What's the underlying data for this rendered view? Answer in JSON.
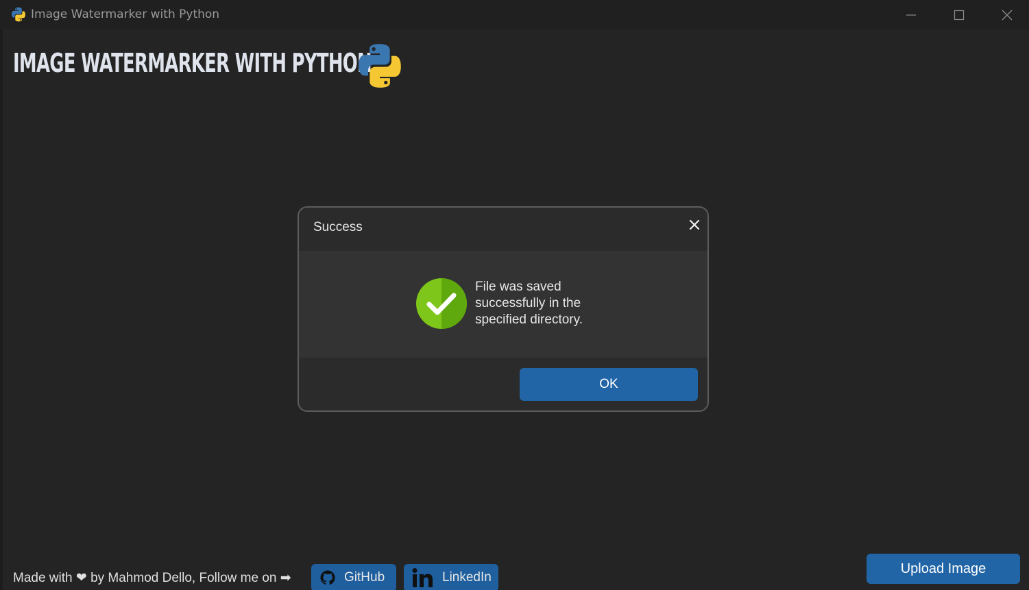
{
  "window": {
    "title": "Image Watermarker with Python",
    "icons": [
      "python-logo-icon",
      "minimize-icon",
      "maximize-icon",
      "close-icon"
    ]
  },
  "header": {
    "title": "IMAGE WATERMARKER WITH PYTHON",
    "logo_icon": "python-logo-icon"
  },
  "dialog": {
    "title": "Success",
    "message": "File was saved successfully in the specified directory.",
    "icon": "success-check-icon",
    "ok_label": "OK",
    "close_icon": "close-icon"
  },
  "footer": {
    "credit_text": "Made with ❤ by Mahmod Dello, Follow me on ➡",
    "github_label": "GitHub",
    "linkedin_label": "LinkedIn",
    "upload_label": "Upload Image"
  },
  "colors": {
    "background": "#242424",
    "titlebar": "#202020",
    "accent": "#2165a6",
    "success_green": "#7ec61a"
  }
}
